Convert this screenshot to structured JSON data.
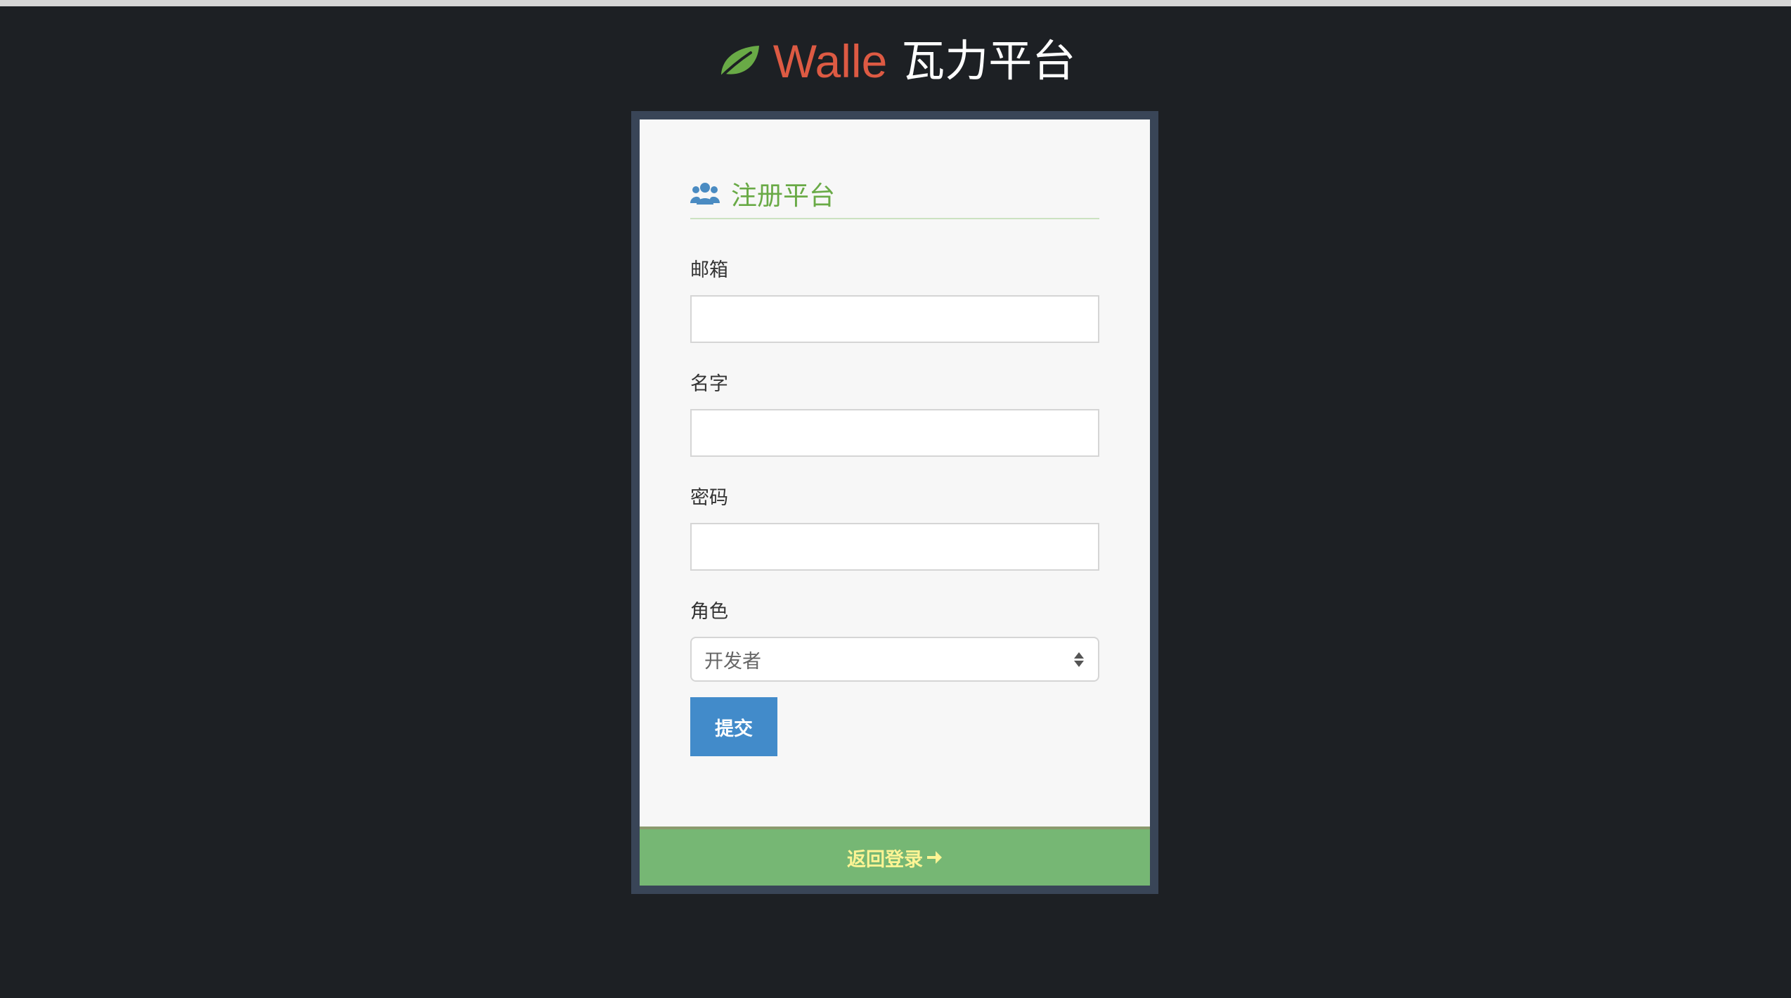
{
  "brand": {
    "name": "Walle",
    "subtitle": "瓦力平台",
    "logo_icon": "leaf-icon",
    "name_color": "#dd5a43",
    "logo_color": "#69aa46"
  },
  "form": {
    "header_icon": "users-icon",
    "title": "注册平台",
    "fields": {
      "email": {
        "label": "邮箱",
        "value": ""
      },
      "name": {
        "label": "名字",
        "value": ""
      },
      "password": {
        "label": "密码",
        "value": ""
      },
      "role": {
        "label": "角色",
        "selected": "开发者"
      }
    },
    "submit_label": "提交",
    "submit_color": "#428bca"
  },
  "footer": {
    "back_label": "返回登录",
    "arrow_icon": "arrow-right-icon",
    "background_color": "#76b774",
    "text_color": "#fef494"
  }
}
